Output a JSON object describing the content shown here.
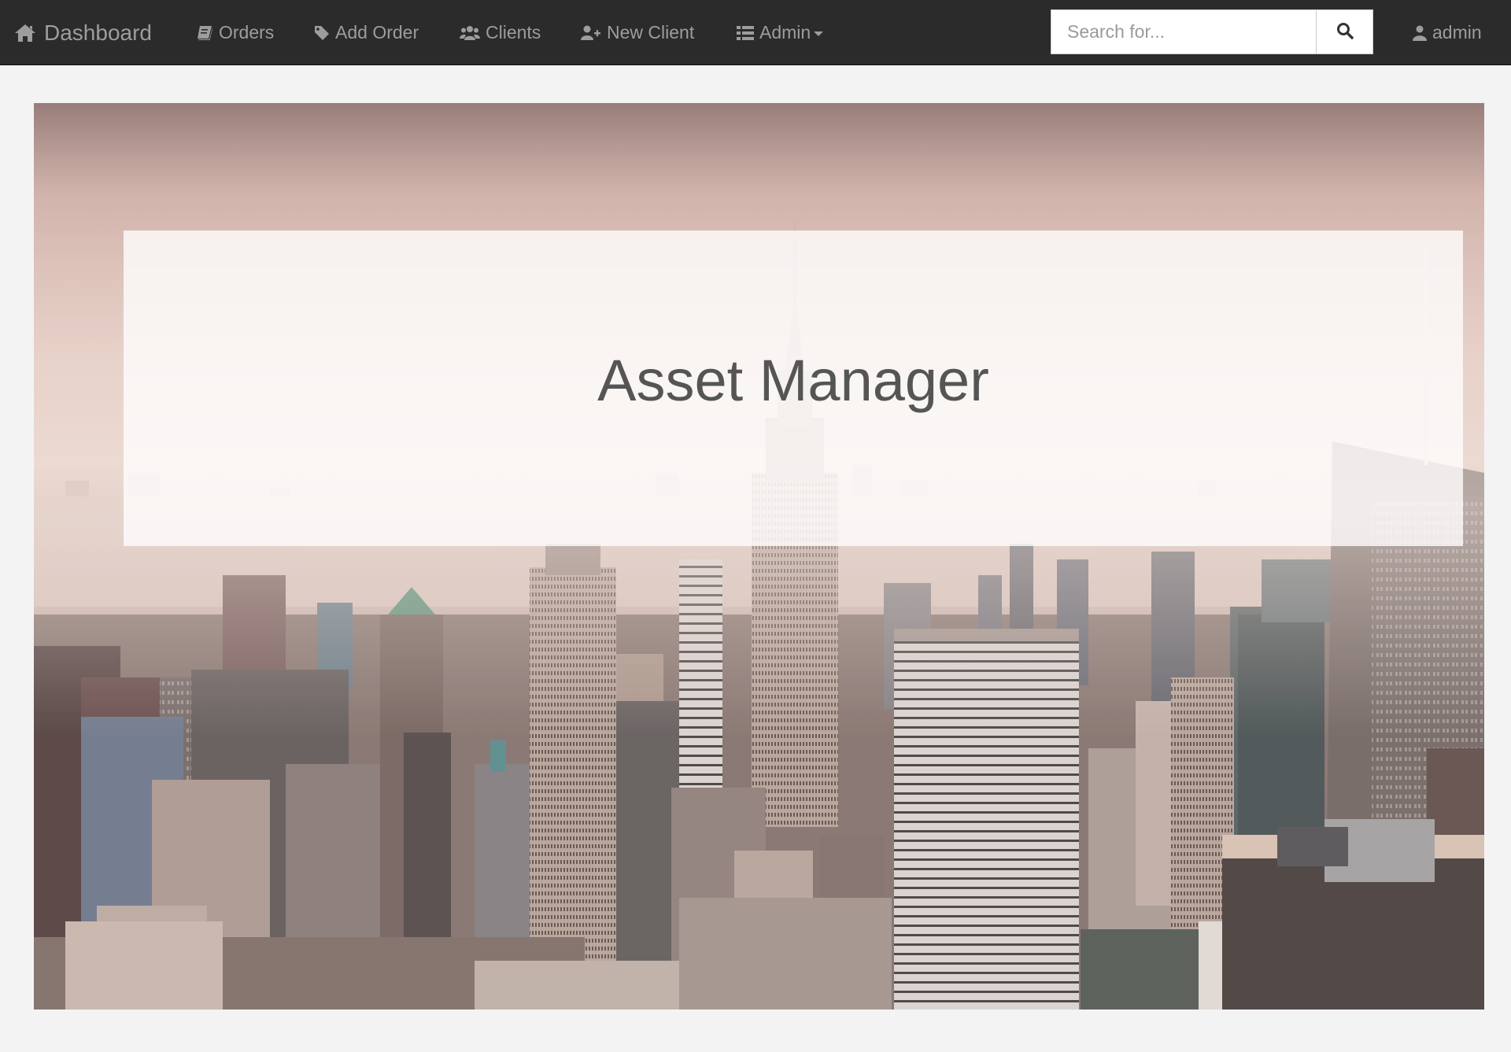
{
  "navbar": {
    "brand": {
      "label": "Dashboard",
      "icon": "home-icon"
    },
    "items": [
      {
        "label": "Orders",
        "icon": "book-icon"
      },
      {
        "label": "Add Order",
        "icon": "tag-icon"
      },
      {
        "label": "Clients",
        "icon": "users-icon"
      },
      {
        "label": "New Client",
        "icon": "user-plus-icon"
      },
      {
        "label": "Admin",
        "icon": "list-icon"
      }
    ],
    "search": {
      "placeholder": "Search for...",
      "value": "",
      "button_icon": "search-icon"
    },
    "user": {
      "label": "admin",
      "icon": "user-icon"
    }
  },
  "hero": {
    "title": "Asset Manager",
    "background": "city-skyline-photo"
  },
  "colors": {
    "navbar_bg": "#2b2b2b",
    "nav_text": "#9d9d9d",
    "page_bg": "#f3f3f3",
    "title_text": "#555555"
  }
}
